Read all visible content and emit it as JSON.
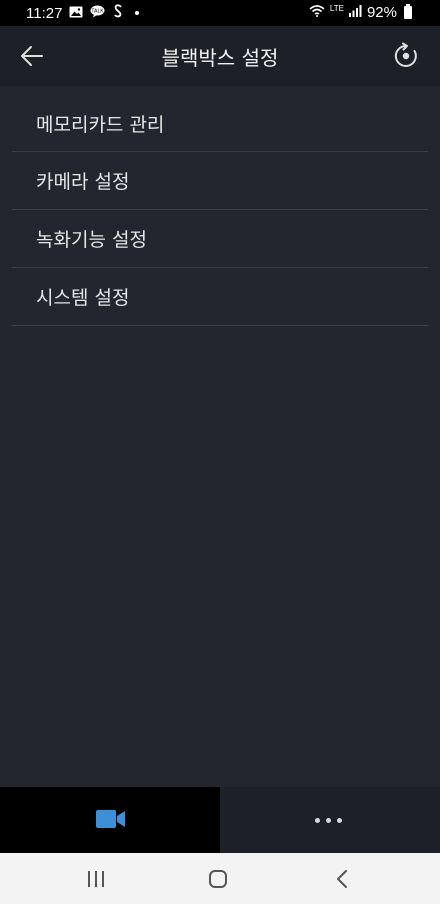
{
  "status_bar": {
    "time": "11:27",
    "lte": "LTE",
    "battery_percent": "92%",
    "icons": [
      "image-icon",
      "chat-bubble-icon",
      "s-app-icon",
      "notification-dot",
      "wifi-icon",
      "signal-icon",
      "battery-icon"
    ]
  },
  "app_bar": {
    "title": "블랙박스 설정",
    "back_icon": "arrow-left-icon",
    "action_icon": "reset-icon"
  },
  "menu": {
    "items": [
      {
        "label": "메모리카드 관리"
      },
      {
        "label": "카메라 설정"
      },
      {
        "label": "녹화기능 설정"
      },
      {
        "label": "시스템 설정"
      }
    ]
  },
  "tab_bar": {
    "tabs": [
      {
        "icon": "video-camera-icon",
        "active": true,
        "color": "#3d8fd6"
      },
      {
        "icon": "more-dots-icon",
        "active": false
      }
    ]
  },
  "nav_bar": {
    "buttons": [
      "recents-icon",
      "home-icon",
      "back-icon"
    ]
  },
  "colors": {
    "background": "#24262f",
    "app_bar": "#1e2028",
    "divider": "#3a3d46",
    "accent": "#3d8fd6"
  }
}
